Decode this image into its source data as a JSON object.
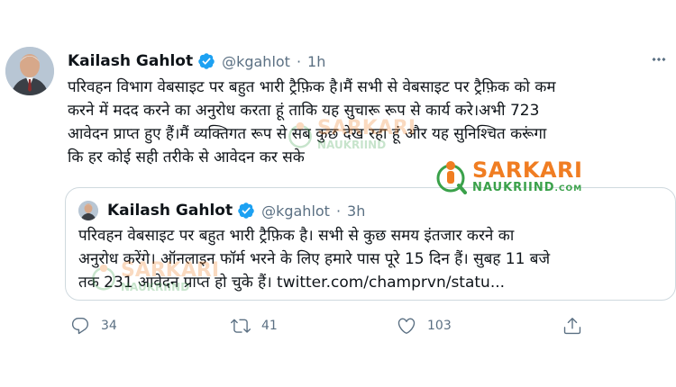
{
  "tweet": {
    "author_name": "Kailash Gahlot",
    "handle": "@kgahlot",
    "separator": "·",
    "time": "1h",
    "text_lines": [
      "परिवहन विभाग वेबसाइट पर बहुत भारी ट्रैफ़िक है।मैं सभी से वेबसाइट पर ट्रैफ़िक को कम",
      "करने में मदद करने का अनुरोध करता हूं ताकि यह सुचारू रूप से कार्य करे।अभी 723",
      "आवेदन प्राप्त हुए हैं।मैं व्यक्तिगत रूप से सब कुछ देख रहा हूं और यह सुनिश्चित करूंगा",
      "कि हर कोई सही तरीके से आवेदन कर सके"
    ]
  },
  "quoted_tweet": {
    "author_name": "Kailash Gahlot",
    "handle": "@kgahlot",
    "separator": "·",
    "time": "3h",
    "text_lines": [
      "परिवहन वेबसाइट पर बहुत भारी ट्रैफ़िक है। सभी से कुछ समय इंतजार करने का",
      "अनुरोध करेंगे। ऑनलाइन फॉर्म भरने के लिए हमारे पास पूरे 15 दिन हैं। सुबह 11 बजे",
      "तक 231 आवेदन प्राप्त हो चुके हैं। twitter.com/champrvn/statu..."
    ]
  },
  "actions": {
    "reply_count": "34",
    "retweet_count": "41",
    "like_count": "103"
  },
  "watermark": {
    "line1": "SARKARI",
    "line2": "NAUKRIIND",
    "suffix": ".COM"
  },
  "icons": {
    "verified": "verified-badge-icon",
    "more": "more-icon",
    "reply": "reply-icon",
    "retweet": "retweet-icon",
    "like": "like-icon",
    "share": "share-icon"
  },
  "colors": {
    "verified_blue": "#1da1f2",
    "secondary_text": "#5b7083",
    "watermark_orange": "#f07d22",
    "watermark_green": "#3aa14a"
  }
}
